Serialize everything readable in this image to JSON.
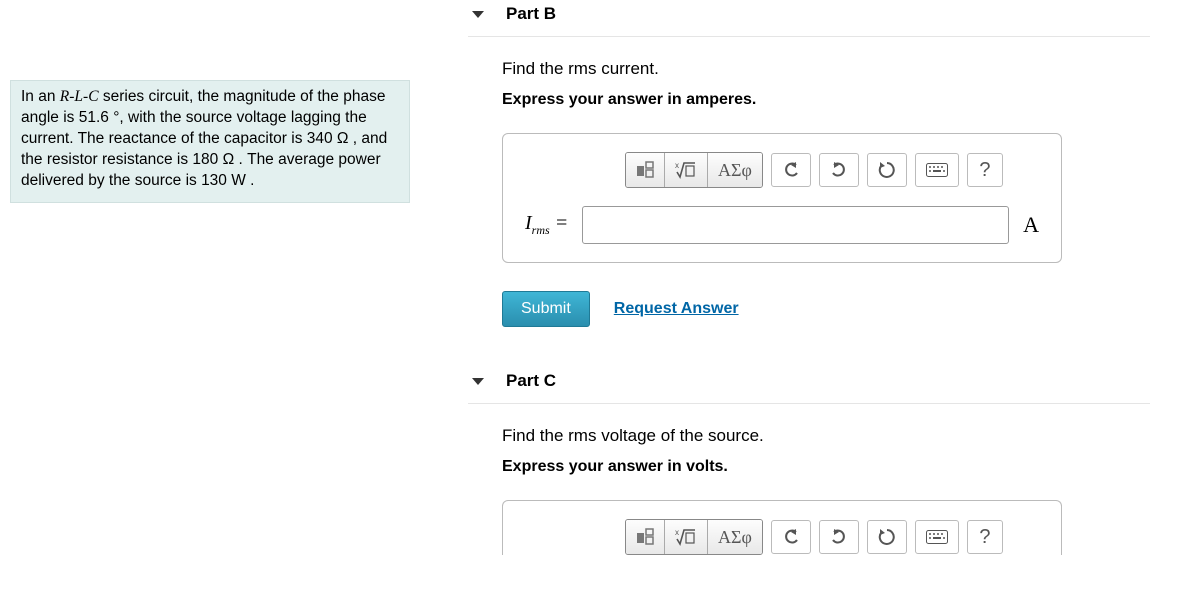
{
  "problem": {
    "text_html": "In an <span class='ital'>R-L-C</span> series circuit, the magnitude of the phase angle is 51.6&nbsp;&deg;, with the source voltage lagging the current. The reactance of the capacitor is 340 &Omega; , and the resistor resistance is 180 &Omega; . The average power delivered by the source is 130 W ."
  },
  "parts": [
    {
      "label": "Part B",
      "prompt": "Find the rms current.",
      "instruction": "Express your answer in amperes.",
      "variable_html": "<span class='ital'>I</span><span class='sub'>rms</span> =",
      "unit": "A",
      "toolbar": {
        "greek": "ΑΣφ"
      },
      "submit": "Submit",
      "request": "Request Answer"
    },
    {
      "label": "Part C",
      "prompt": "Find the rms voltage of the source.",
      "instruction": "Express your answer in volts.",
      "toolbar": {
        "greek": "ΑΣφ"
      }
    }
  ]
}
